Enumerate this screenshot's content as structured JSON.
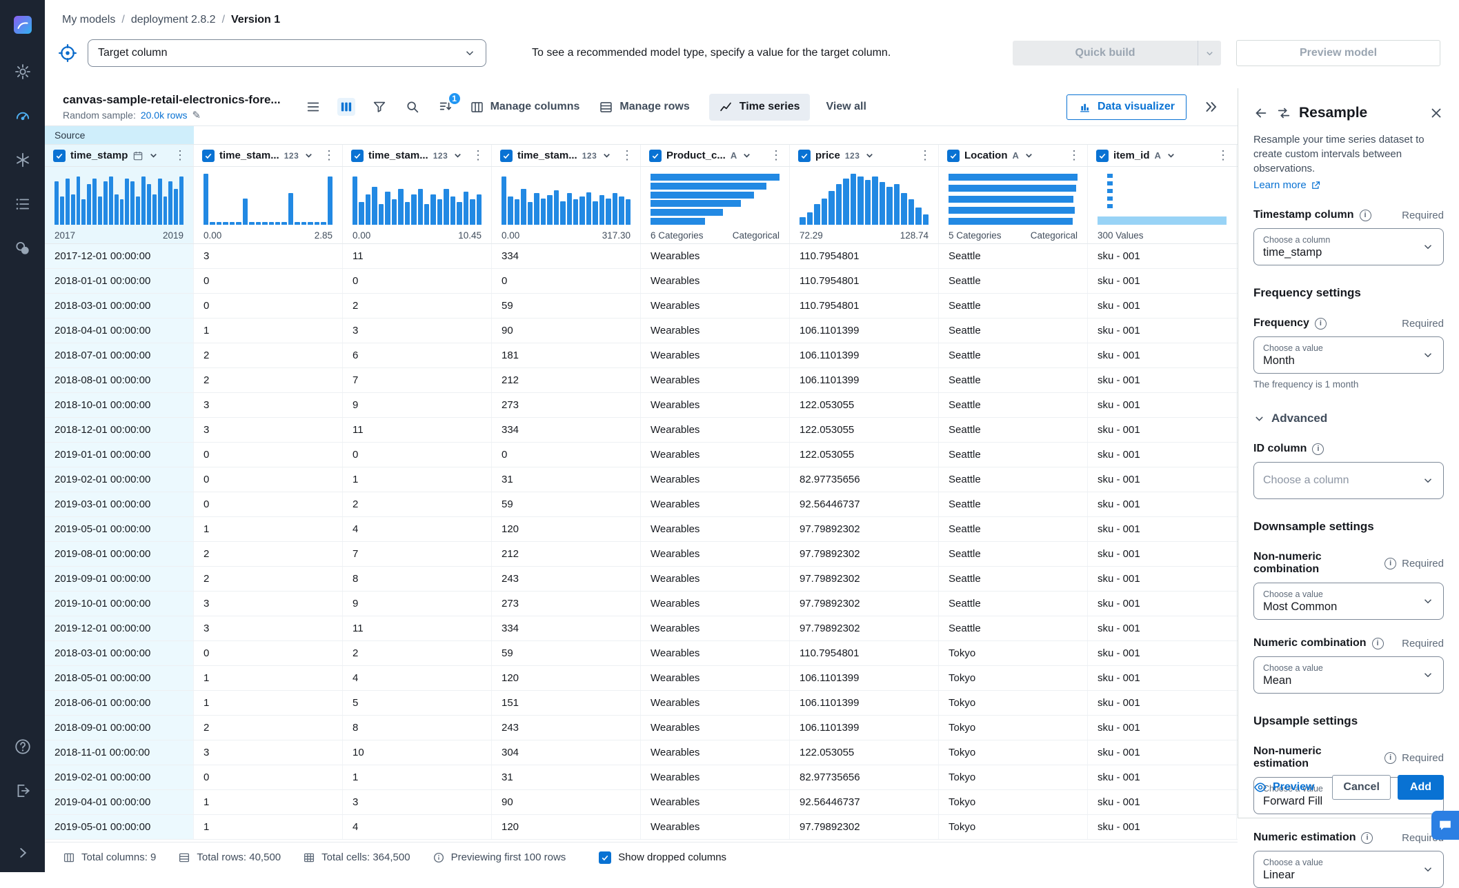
{
  "breadcrumb": {
    "items": [
      "My models",
      "deployment 2.8.2",
      "Version 1"
    ],
    "separator": "/"
  },
  "header": {
    "target_placeholder": "Target column",
    "hint": "To see a recommended model type, specify a value for the target column.",
    "quick_build": "Quick build",
    "preview_model": "Preview model"
  },
  "toolbar": {
    "dataset_name": "canvas-sample-retail-electronics-fore...",
    "random_sample_label": "Random sample:",
    "random_sample_value": "20.0k rows",
    "sort_badge": "1",
    "manage_columns": "Manage columns",
    "manage_rows": "Manage rows",
    "time_series": "Time series",
    "view_all": "View all",
    "data_visualizer": "Data visualizer"
  },
  "table": {
    "source_tab": "Source",
    "type_glyphs": {
      "number": "123",
      "text": "A"
    },
    "columns": [
      {
        "name": "time_stamp",
        "type": "date",
        "selected": true,
        "hist": {
          "kind": "vbar",
          "min": "2017",
          "max": "2019",
          "values": [
            0.85,
            0.55,
            0.9,
            0.6,
            0.95,
            0.5,
            0.8,
            0.9,
            0.55,
            0.85,
            0.95,
            0.6,
            0.5,
            0.9,
            0.85,
            0.55,
            0.95,
            0.8,
            0.6,
            0.9,
            0.55,
            0.85,
            0.7,
            0.95
          ]
        }
      },
      {
        "name": "time_stam...",
        "type": "number",
        "hist": {
          "kind": "vbar",
          "min": "0.00",
          "max": "2.85",
          "values": [
            1,
            0.06,
            0.06,
            0.06,
            0.06,
            0.06,
            0.52,
            0.06,
            0.06,
            0.06,
            0.06,
            0.06,
            0.06,
            0.62,
            0.06,
            0.06,
            0.06,
            0.06,
            0.06,
            0.95
          ]
        }
      },
      {
        "name": "time_stam...",
        "type": "number",
        "hist": {
          "kind": "vbar",
          "min": "0.00",
          "max": "10.45",
          "values": [
            0.95,
            0.45,
            0.6,
            0.75,
            0.4,
            0.65,
            0.5,
            0.7,
            0.45,
            0.6,
            0.7,
            0.4,
            0.6,
            0.5,
            0.7,
            0.55,
            0.45,
            0.65,
            0.5,
            0.6
          ]
        }
      },
      {
        "name": "time_stam...",
        "type": "number",
        "hist": {
          "kind": "vbar",
          "min": "0.00",
          "max": "317.30",
          "values": [
            0.95,
            0.55,
            0.5,
            0.7,
            0.45,
            0.62,
            0.52,
            0.58,
            0.68,
            0.46,
            0.62,
            0.5,
            0.56,
            0.64,
            0.46,
            0.58,
            0.52,
            0.62,
            0.56,
            0.5
          ]
        }
      },
      {
        "name": "Product_c...",
        "type": "text",
        "hist": {
          "kind": "hbar",
          "min": "6 Categories",
          "max": "Categorical",
          "values": [
            1,
            0.9,
            0.8,
            0.7,
            0.56,
            0.42
          ]
        }
      },
      {
        "name": "price",
        "type": "number",
        "hist": {
          "kind": "vbar",
          "min": "72.29",
          "max": "128.74",
          "values": [
            0.15,
            0.25,
            0.4,
            0.52,
            0.66,
            0.8,
            0.9,
            1,
            0.95,
            0.88,
            0.94,
            0.84,
            0.74,
            0.8,
            0.62,
            0.5,
            0.34,
            0.2
          ]
        }
      },
      {
        "name": "Location",
        "type": "text",
        "hist": {
          "kind": "hbar",
          "min": "5 Categories",
          "max": "Categorical",
          "values": [
            1,
            0.99,
            0.97,
            0.98,
            0.96
          ]
        }
      },
      {
        "name": "item_id",
        "type": "text",
        "hist": {
          "kind": "item",
          "min": "300 Values",
          "max": ""
        }
      }
    ],
    "rows": [
      [
        "2017-12-01 00:00:00",
        "3",
        "11",
        "334",
        "Wearables",
        "110.7954801",
        "Seattle",
        "sku - 001"
      ],
      [
        "2018-01-01 00:00:00",
        "0",
        "0",
        "0",
        "Wearables",
        "110.7954801",
        "Seattle",
        "sku - 001"
      ],
      [
        "2018-03-01 00:00:00",
        "0",
        "2",
        "59",
        "Wearables",
        "110.7954801",
        "Seattle",
        "sku - 001"
      ],
      [
        "2018-04-01 00:00:00",
        "1",
        "3",
        "90",
        "Wearables",
        "106.1101399",
        "Seattle",
        "sku - 001"
      ],
      [
        "2018-07-01 00:00:00",
        "2",
        "6",
        "181",
        "Wearables",
        "106.1101399",
        "Seattle",
        "sku - 001"
      ],
      [
        "2018-08-01 00:00:00",
        "2",
        "7",
        "212",
        "Wearables",
        "106.1101399",
        "Seattle",
        "sku - 001"
      ],
      [
        "2018-10-01 00:00:00",
        "3",
        "9",
        "273",
        "Wearables",
        "122.053055",
        "Seattle",
        "sku - 001"
      ],
      [
        "2018-12-01 00:00:00",
        "3",
        "11",
        "334",
        "Wearables",
        "122.053055",
        "Seattle",
        "sku - 001"
      ],
      [
        "2019-01-01 00:00:00",
        "0",
        "0",
        "0",
        "Wearables",
        "122.053055",
        "Seattle",
        "sku - 001"
      ],
      [
        "2019-02-01 00:00:00",
        "0",
        "1",
        "31",
        "Wearables",
        "82.97735656",
        "Seattle",
        "sku - 001"
      ],
      [
        "2019-03-01 00:00:00",
        "0",
        "2",
        "59",
        "Wearables",
        "92.56446737",
        "Seattle",
        "sku - 001"
      ],
      [
        "2019-05-01 00:00:00",
        "1",
        "4",
        "120",
        "Wearables",
        "97.79892302",
        "Seattle",
        "sku - 001"
      ],
      [
        "2019-08-01 00:00:00",
        "2",
        "7",
        "212",
        "Wearables",
        "97.79892302",
        "Seattle",
        "sku - 001"
      ],
      [
        "2019-09-01 00:00:00",
        "2",
        "8",
        "243",
        "Wearables",
        "97.79892302",
        "Seattle",
        "sku - 001"
      ],
      [
        "2019-10-01 00:00:00",
        "3",
        "9",
        "273",
        "Wearables",
        "97.79892302",
        "Seattle",
        "sku - 001"
      ],
      [
        "2019-12-01 00:00:00",
        "3",
        "11",
        "334",
        "Wearables",
        "97.79892302",
        "Seattle",
        "sku - 001"
      ],
      [
        "2018-03-01 00:00:00",
        "0",
        "2",
        "59",
        "Wearables",
        "110.7954801",
        "Tokyo",
        "sku - 001"
      ],
      [
        "2018-05-01 00:00:00",
        "1",
        "4",
        "120",
        "Wearables",
        "106.1101399",
        "Tokyo",
        "sku - 001"
      ],
      [
        "2018-06-01 00:00:00",
        "1",
        "5",
        "151",
        "Wearables",
        "106.1101399",
        "Tokyo",
        "sku - 001"
      ],
      [
        "2018-09-01 00:00:00",
        "2",
        "8",
        "243",
        "Wearables",
        "106.1101399",
        "Tokyo",
        "sku - 001"
      ],
      [
        "2018-11-01 00:00:00",
        "3",
        "10",
        "304",
        "Wearables",
        "122.053055",
        "Tokyo",
        "sku - 001"
      ],
      [
        "2019-02-01 00:00:00",
        "0",
        "1",
        "31",
        "Wearables",
        "82.97735656",
        "Tokyo",
        "sku - 001"
      ],
      [
        "2019-04-01 00:00:00",
        "1",
        "3",
        "90",
        "Wearables",
        "92.56446737",
        "Tokyo",
        "sku - 001"
      ],
      [
        "2019-05-01 00:00:00",
        "1",
        "4",
        "120",
        "Wearables",
        "97.79892302",
        "Tokyo",
        "sku - 001"
      ]
    ]
  },
  "statusbar": {
    "total_columns": "Total columns: 9",
    "total_rows": "Total rows: 40,500",
    "total_cells": "Total cells: 364,500",
    "previewing": "Previewing first 100 rows",
    "show_dropped": "Show dropped columns"
  },
  "panel": {
    "title": "Resample",
    "description": "Resample your time series dataset to create custom intervals between observations.",
    "learn_more": "Learn more",
    "required": "Required",
    "sections": {
      "frequency": "Frequency settings",
      "advanced": "Advanced",
      "downsample": "Downsample settings",
      "upsample": "Upsample settings"
    },
    "timestamp": {
      "label": "Timestamp column",
      "floating": "Choose a column",
      "value": "time_stamp"
    },
    "frequency": {
      "label": "Frequency",
      "floating": "Choose a value",
      "value": "Month",
      "helper": "The frequency is 1 month"
    },
    "id_column": {
      "label": "ID column",
      "placeholder": "Choose a column"
    },
    "non_numeric_combination": {
      "label": "Non-numeric combination",
      "floating": "Choose a value",
      "value": "Most Common"
    },
    "numeric_combination": {
      "label": "Numeric combination",
      "floating": "Choose a value",
      "value": "Mean"
    },
    "non_numeric_estimation": {
      "label": "Non-numeric estimation",
      "floating": "Choose a value",
      "value": "Forward Fill"
    },
    "numeric_estimation": {
      "label": "Numeric estimation",
      "floating": "Choose a value",
      "value": "Linear"
    },
    "footer": {
      "preview": "Preview",
      "cancel": "Cancel",
      "add": "Add"
    }
  },
  "colors": {
    "accent": "#0972d3",
    "histogram_bar": "#2289e3",
    "selected_column_bg": "#e8f7fd",
    "nav_bg": "#1c2431"
  }
}
